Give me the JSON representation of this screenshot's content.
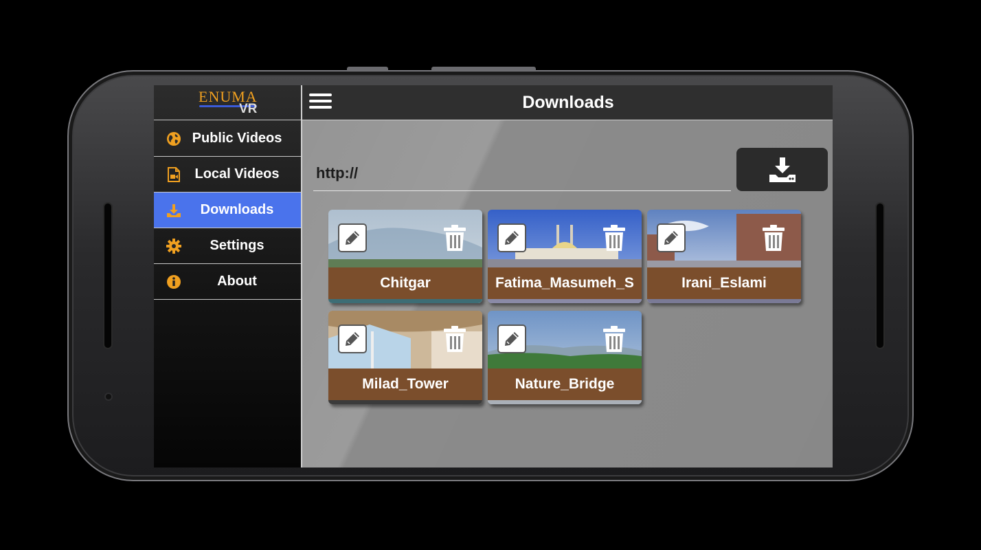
{
  "logo": {
    "text": "ENUMA",
    "sub": "VR"
  },
  "sidebar": {
    "items": [
      {
        "label": "Public Videos",
        "icon": "globe-icon"
      },
      {
        "label": "Local Videos",
        "icon": "video-file-icon"
      },
      {
        "label": "Downloads",
        "icon": "download-icon",
        "active": true
      },
      {
        "label": "Settings",
        "icon": "gear-icon"
      },
      {
        "label": "About",
        "icon": "info-icon"
      }
    ]
  },
  "header": {
    "title": "Downloads",
    "menu_icon": "hamburger-icon"
  },
  "url_field": {
    "value": "http://",
    "placeholder": ""
  },
  "download_button": {
    "icon": "download-tray-icon"
  },
  "videos": [
    {
      "name": "Chitgar"
    },
    {
      "name": "Fatima_Masumeh_S"
    },
    {
      "name": "Irani_Eslami"
    },
    {
      "name": "Milad_Tower"
    },
    {
      "name": "Nature_Bridge"
    }
  ],
  "colors": {
    "accent": "#4a73ec",
    "label_brown": "#7b4e2c",
    "icon_orange": "#f0a020",
    "content_bg": "#8b8b8b",
    "appbar_bg": "#2f2f2f"
  }
}
